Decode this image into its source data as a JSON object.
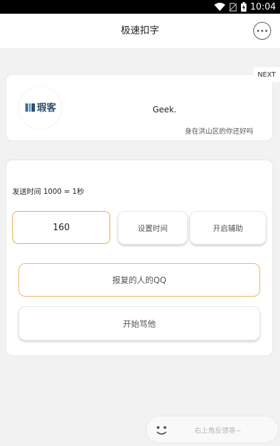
{
  "status_bar": {
    "time": "10:04"
  },
  "header": {
    "title": "极速扣字"
  },
  "profile_card": {
    "next_label": "NEXT",
    "logo_text": "瑕客",
    "name": "Geek.",
    "subtitle": "身在洪山区的你还好吗"
  },
  "control_card": {
    "send_label": "发送时间 1000 = 1秒",
    "interval_value": "160",
    "set_time_label": "设置时间",
    "open_assist_label": "开启辅助",
    "qq_placeholder": "报复的人的QQ",
    "start_label": "开始骂他"
  },
  "feedback": {
    "text": "右上角反馈等~"
  },
  "colors": {
    "accent_border": "#e8a94a",
    "background": "#f2f2f2"
  },
  "icons": [
    "wifi-icon",
    "no-sim-icon",
    "battery-icon",
    "more-icon",
    "logo-icon",
    "smiley-icon"
  ]
}
